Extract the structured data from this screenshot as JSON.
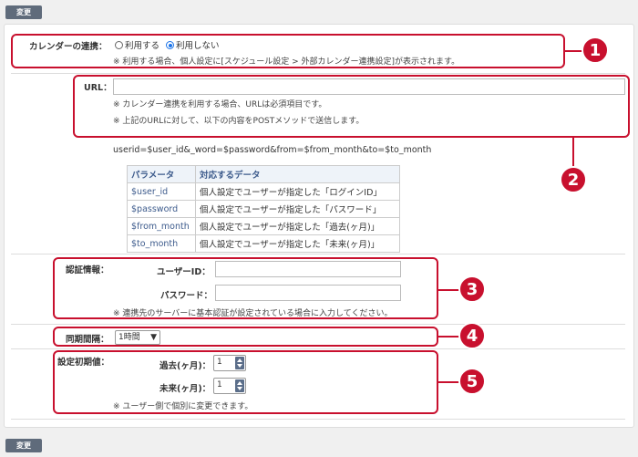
{
  "buttons": {
    "top_label": "変更",
    "bottom_label": "変更"
  },
  "calendar": {
    "label": "カレンダーの連携：",
    "option_use": "利用する",
    "option_no_use": "利用しない",
    "selected": "利用しない",
    "note": "※ 利用する場合、個人設定に[スケジュール設定 > 外部カレンダー連携設定]が表示されます。"
  },
  "url": {
    "label": "URL：",
    "value": "",
    "note1": "※ カレンダー連携を利用する場合、URLは必須項目です。",
    "note2": "※ 上記のURLに対して、以下の内容をPOSTメソッドで送信します。",
    "post_format": "userid=$user_id&_word=$password&from=$from_month&to=$to_month"
  },
  "param_table": {
    "headers": [
      "パラメータ",
      "対応するデータ"
    ],
    "rows": [
      [
        "$user_id",
        "個人設定でユーザーが指定した「ログインID」"
      ],
      [
        "$password",
        "個人設定でユーザーが指定した「パスワード」"
      ],
      [
        "$from_month",
        "個人設定でユーザーが指定した「過去(ヶ月)」"
      ],
      [
        "$to_month",
        "個人設定でユーザーが指定した「未来(ヶ月)」"
      ]
    ]
  },
  "auth": {
    "label": "認証情報：",
    "user_id_label": "ユーザーID：",
    "user_id_value": "",
    "password_label": "パスワード：",
    "password_value": "",
    "note": "※ 連携先のサーバーに基本認証が設定されている場合に入力してください。"
  },
  "sync": {
    "label": "同期間隔：",
    "selected": "1時間"
  },
  "defaults": {
    "label": "設定初期値：",
    "past_label": "過去(ヶ月)：",
    "past_value": "1",
    "future_label": "未来(ヶ月)：",
    "future_value": "1",
    "note": "※ ユーザー側で個別に変更できます。"
  },
  "callouts": [
    "1",
    "2",
    "3",
    "4",
    "5"
  ],
  "colors": {
    "accent": "#c8102e",
    "button": "#5f6b7b",
    "radio": "#1a73e8"
  }
}
